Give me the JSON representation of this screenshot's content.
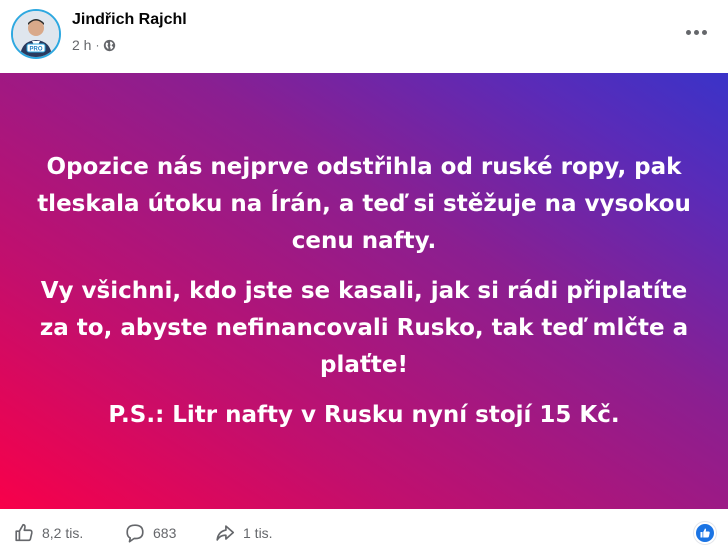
{
  "post": {
    "author": "Jindřich Rajchl",
    "time": "2 h",
    "separator": "·",
    "avatar_badge": "PRO",
    "paragraphs": [
      "Opozice nás nejprve odstřihla od ruské ropy, pak tleskala útoku na Írán, a teď si stěžuje na vysokou cenu nafty.",
      "Vy všichni, kdo jste se kasali, jak si rádi připlatíte za to, abyste nefinancovali Rusko, tak teď mlčte a plaťte!",
      "P.S.: Litr nafty v Rusku nyní stojí 15 Kč."
    ]
  },
  "stats": {
    "likes": "8,2 tis.",
    "comments": "683",
    "shares": "1 tis."
  },
  "icons": {
    "privacy": "globe-icon",
    "more": "more-options-icon",
    "like": "thumbs-up-icon",
    "comment": "comment-icon",
    "share": "share-icon",
    "reaction": "like-reaction-icon"
  },
  "colors": {
    "gradient_start": "#f8004a",
    "gradient_end": "#3a33c8",
    "text_on_card": "#ffffff",
    "meta": "#65676b",
    "reaction_blue": "#1b74e4"
  }
}
